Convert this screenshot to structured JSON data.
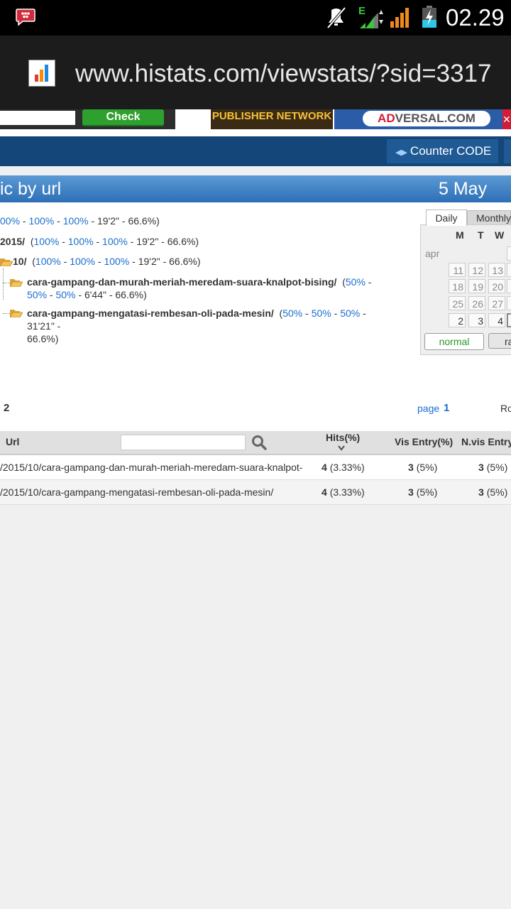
{
  "status": {
    "time": "02.29",
    "network": "E"
  },
  "browser": {
    "url": "www.histats.com/viewstats/?sid=3317"
  },
  "ads": {
    "check_label": "Check",
    "publisher_label": "PUBLISHER NETWORK",
    "adversal_prefix": "AD",
    "adversal_suffix": "VERSAL.COM",
    "close_label": "✕"
  },
  "nav": {
    "counter_code": "Counter CODE"
  },
  "title": {
    "text": "ic by url",
    "date": "5 May"
  },
  "tree": {
    "line1": {
      "p1": "00%",
      "p2": "100%",
      "p3": "100%",
      "tail": " - 19'2\" - 66.6%)"
    },
    "line2": {
      "name": "2015/",
      "p1": "100%",
      "p2": "100%",
      "p3": "100%",
      "tail": " - 19'2\" - 66.6%)"
    },
    "line3": {
      "name": "10/",
      "p1": "100%",
      "p2": "100%",
      "p3": "100%",
      "tail": " - 19'2\" - 66.6%)"
    },
    "line4": {
      "name": "cara-gampang-dan-murah-meriah-meredam-suara-knalpot-bising/",
      "p1": "50%",
      "p2": "50%",
      "p3": "50%",
      "tail": " - 6'44\" - 66.6%)"
    },
    "line5": {
      "name": "cara-gampang-mengatasi-rembesan-oli-pada-mesin/",
      "p1": "50%",
      "p2": "50%",
      "p3": "50%",
      "tail1": " - 31'21\" -",
      "tail2": "66.6%)"
    }
  },
  "calendar": {
    "tab_daily": "Daily",
    "tab_monthly": "Monthly",
    "day_headers": [
      "M",
      "T",
      "W"
    ],
    "month_label": "apr",
    "days": [
      "11",
      "12",
      "13",
      "18",
      "19",
      "20",
      "25",
      "26",
      "27",
      "2",
      "3",
      "4"
    ],
    "btn_normal": "normal",
    "btn_ra": "ra"
  },
  "pagination": {
    "count": "2",
    "page_label": "page",
    "page_number": "1",
    "rows_label": "Ro"
  },
  "table": {
    "headers": {
      "url": "Url",
      "hits": "Hits(%)",
      "vis_entry": "Vis Entry(%)",
      "nvis_entry": "N.vis Entry(%)"
    },
    "rows": [
      {
        "url": "/2015/10/cara-gampang-dan-murah-meriah-meredam-suara-knalpot-",
        "hits": "4",
        "hits_pct": "(3.33%)",
        "vis": "3",
        "vis_pct": "(5%)",
        "nvis": "3",
        "nvis_pct": "(5%)"
      },
      {
        "url": "/2015/10/cara-gampang-mengatasi-rembesan-oli-pada-mesin/",
        "hits": "4",
        "hits_pct": "(3.33%)",
        "vis": "3",
        "vis_pct": "(5%)",
        "nvis": "3",
        "nvis_pct": "(5%)"
      }
    ]
  },
  "colors": {
    "navy": "#14467a",
    "title_blue": "#3d7fc4",
    "link_blue": "#1a6fcf",
    "green": "#2ea02e"
  }
}
